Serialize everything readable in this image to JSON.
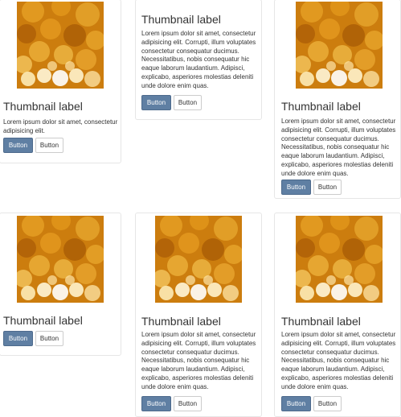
{
  "thumbnails": [
    {
      "label": "Thumbnail label",
      "text": "Lorem ipsum dolor sit amet, consectetur adipisicing elit.",
      "primary_button": "Button",
      "default_button": "Button"
    },
    {
      "label": "Thumbnail label",
      "text": "Lorem ipsum dolor sit amet, consectetur adipisicing elit. Corrupti, illum voluptates consectetur consequatur ducimus. Necessitatibus, nobis consequatur hic eaque laborum laudantium. Adipisci, explicabo, asperiores molestias deleniti unde dolore enim quas.",
      "primary_button": "Button",
      "default_button": "Button"
    },
    {
      "label": "Thumbnail label",
      "text": "Lorem ipsum dolor sit amet, consectetur adipisicing elit. Corrupti, illum voluptates consectetur consequatur ducimus. Necessitatibus, nobis consequatur hic eaque laborum laudantium. Adipisci, explicabo, asperiores molestias deleniti unde dolore enim quas.",
      "primary_button": "Button",
      "default_button": "Button"
    },
    {
      "label": "Thumbnail label",
      "primary_button": "Button",
      "default_button": "Button"
    },
    {
      "label": "Thumbnail label",
      "text": "Lorem ipsum dolor sit amet, consectetur adipisicing elit. Corrupti, illum voluptates consectetur consequatur ducimus. Necessitatibus, nobis consequatur hic eaque laborum laudantium. Adipisci, explicabo, asperiores molestias deleniti unde dolore enim quas.",
      "primary_button": "Button",
      "default_button": "Button"
    },
    {
      "label": "Thumbnail label",
      "text": "Lorem ipsum dolor sit amet, consectetur adipisicing elit. Corrupti, illum voluptates consectetur consequatur ducimus. Necessitatibus, nobis consequatur hic eaque laborum laudantium. Adipisci, explicabo, asperiores molestias deleniti unde dolore enim quas.",
      "primary_button": "Button",
      "default_button": "Button"
    }
  ],
  "colors": {
    "primary_button": "#5f7fa3",
    "card_border": "#e6e6e6",
    "image_orange": "#d98a10"
  }
}
